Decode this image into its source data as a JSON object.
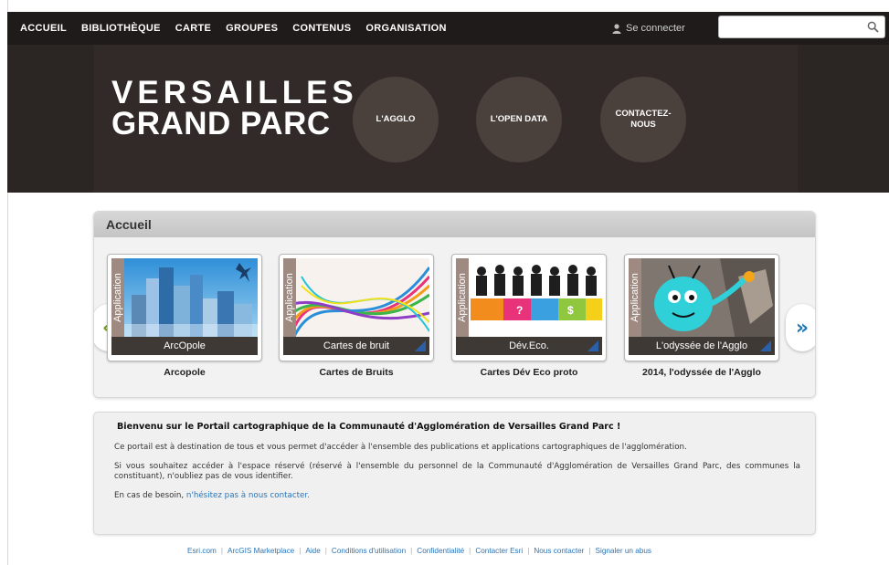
{
  "nav": {
    "links": [
      "ACCUEIL",
      "BIBLIOTHÈQUE",
      "CARTE",
      "GROUPES",
      "CONTENUS",
      "ORGANISATION"
    ],
    "signin_label": "Se connecter",
    "search_placeholder": ""
  },
  "banner": {
    "logo_line1": "VERSAILLES",
    "logo_line2": "GRAND PARC",
    "buttons": [
      "L'AGGLO",
      "L'OPEN DATA",
      "CONTACTEZ-\nNOUS"
    ]
  },
  "gallery": {
    "title": "Accueil",
    "app_label": "Application",
    "prev_icon": "«",
    "next_icon": "»",
    "items": [
      {
        "caption": "ArcOpole",
        "title": "Arcopole"
      },
      {
        "caption": "Cartes de bruit",
        "title": "Cartes de Bruits"
      },
      {
        "caption": "Dév.Eco.",
        "title": "Cartes Dév Eco proto"
      },
      {
        "caption": "L'odyssée de l'Agglo",
        "title": "2014, l'odyssée de l'Agglo"
      }
    ]
  },
  "welcome": {
    "heading": "Bienvenu sur le Portail cartographique de la Communauté d'Agglomération de Versailles Grand Parc !",
    "p1": "Ce portail est à destination de tous et vous permet d'accéder à l'ensemble des publications et applications cartographiques de l'agglomération.",
    "p2": "Si vous souhaitez accéder à l'espace réservé (réservé à l'ensemble du personnel de la Communauté d'Agglomération de Versailles Grand Parc, des communes la constituant), n'oubliez pas de vous identifier.",
    "p3_prefix": "En cas de besoin, ",
    "p3_link": "n'hésitez pas à nous contacter."
  },
  "footer": {
    "links": [
      "Esri.com",
      "ArcGIS Marketplace",
      "Aide",
      "Conditions d'utilisation",
      "Confidentialité",
      "Contacter Esri",
      "Nous contacter",
      "Signaler un abus"
    ]
  },
  "colors": {
    "nav_bg": "#1f1b1a",
    "banner_bg": "#2b2523",
    "link": "#2a74b8"
  }
}
